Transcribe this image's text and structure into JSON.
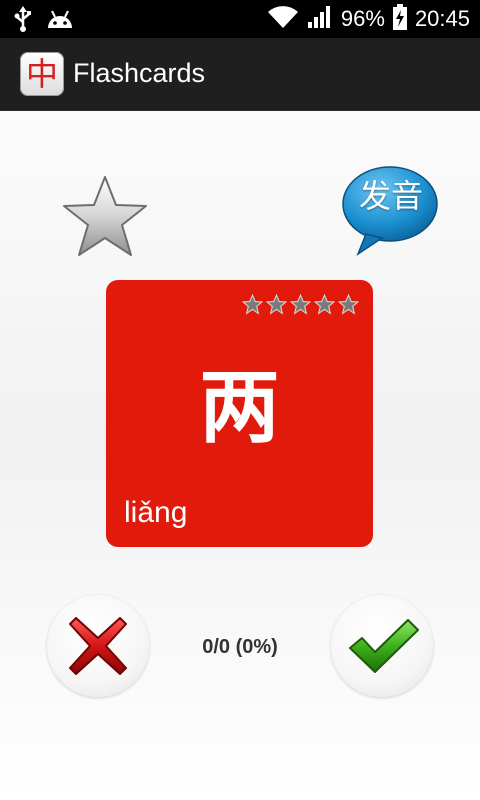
{
  "status_bar": {
    "battery_percent": "96%",
    "time": "20:45",
    "icons": [
      "usb-icon",
      "android-icon",
      "wifi-icon",
      "signal-icon",
      "battery-charging-icon"
    ]
  },
  "action_bar": {
    "app_icon_glyph": "中",
    "title": "Flashcards"
  },
  "pronounce_button": {
    "label": "发音"
  },
  "card": {
    "character": "两",
    "pinyin": "liǎng",
    "rating_stars": 5,
    "color": "#e11a0c"
  },
  "score": {
    "text": "0/0 (0%)"
  },
  "colors": {
    "card_red": "#e11a0c",
    "check_green": "#3fb01b",
    "cross_red": "#d41414",
    "bubble_blue": "#1a8fd0"
  }
}
